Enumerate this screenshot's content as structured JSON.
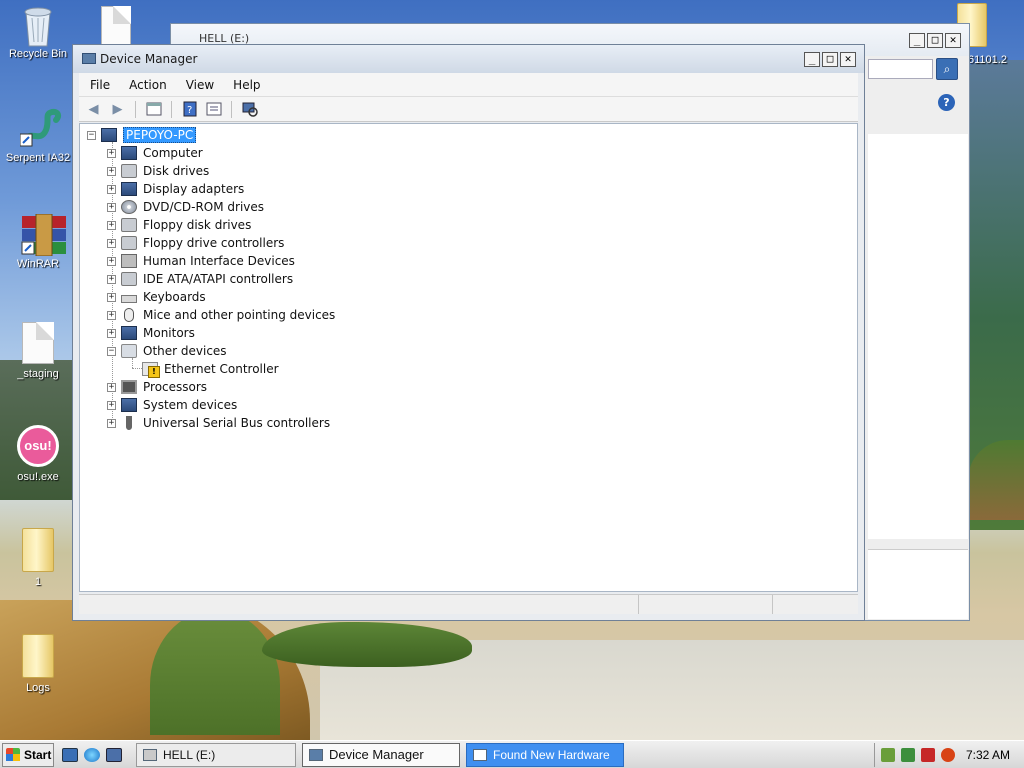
{
  "desktop": {
    "icons": [
      {
        "label": "Recycle Bin"
      },
      {
        "label": "Serpent IA32"
      },
      {
        "label": "WinRAR"
      },
      {
        "label": "_staging"
      },
      {
        "label": "osu!.exe"
      },
      {
        "label": "1"
      },
      {
        "label": "Logs"
      }
    ],
    "osu_badge": "osu!",
    "partial_right_label": "61101.2"
  },
  "background_window": {
    "title": "HELL (E:)",
    "search_icon": "search-icon",
    "help_icon": "?"
  },
  "device_manager": {
    "title": "Device Manager",
    "menu": [
      "File",
      "Action",
      "View",
      "Help"
    ],
    "tree": {
      "root": "PEPOYO-PC",
      "categories": [
        {
          "label": "Computer",
          "icon": "computer-icon"
        },
        {
          "label": "Disk drives",
          "icon": "disk-icon"
        },
        {
          "label": "Display adapters",
          "icon": "display-icon"
        },
        {
          "label": "DVD/CD-ROM drives",
          "icon": "dvd-icon"
        },
        {
          "label": "Floppy disk drives",
          "icon": "floppy-icon"
        },
        {
          "label": "Floppy drive controllers",
          "icon": "controller-icon"
        },
        {
          "label": "Human Interface Devices",
          "icon": "hid-icon"
        },
        {
          "label": "IDE ATA/ATAPI controllers",
          "icon": "ide-icon"
        },
        {
          "label": "Keyboards",
          "icon": "keyboard-icon"
        },
        {
          "label": "Mice and other pointing devices",
          "icon": "mouse-icon"
        },
        {
          "label": "Monitors",
          "icon": "monitor-icon"
        },
        {
          "label": "Other devices",
          "icon": "other-devices-icon",
          "expanded": true,
          "children": [
            {
              "label": "Ethernet Controller",
              "icon": "warning-device-icon"
            }
          ]
        },
        {
          "label": "Processors",
          "icon": "processor-icon"
        },
        {
          "label": "System devices",
          "icon": "system-icon"
        },
        {
          "label": "Universal Serial Bus controllers",
          "icon": "usb-icon"
        }
      ]
    }
  },
  "taskbar": {
    "start": "Start",
    "buttons": [
      {
        "label": "HELL (E:)"
      },
      {
        "label": "Device Manager"
      },
      {
        "label": "Found New Hardware"
      }
    ],
    "clock": "7:32 AM"
  }
}
